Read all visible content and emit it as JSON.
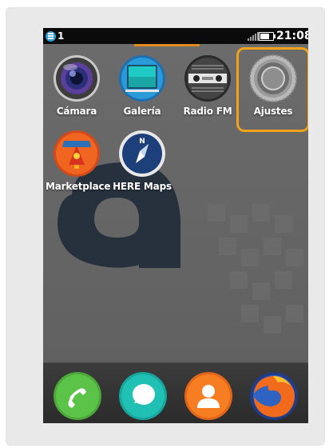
{
  "status_bar": {
    "notification_count": "1",
    "time": "21:08",
    "battery_level": 0.7
  },
  "home_apps": [
    {
      "label": "Cámara",
      "icon": "camera-icon"
    },
    {
      "label": "Galería",
      "icon": "gallery-icon"
    },
    {
      "label": "Radio FM",
      "icon": "radio-icon"
    },
    {
      "label": "Ajustes",
      "icon": "settings-gear-icon"
    },
    {
      "label": "Marketplace",
      "icon": "marketplace-icon"
    },
    {
      "label": "HERE Maps",
      "icon": "compass-icon"
    }
  ],
  "highlighted_app": "Ajustes",
  "dock_apps": [
    {
      "icon": "phone-icon"
    },
    {
      "icon": "messages-icon"
    },
    {
      "icon": "contacts-icon"
    },
    {
      "icon": "firefox-icon"
    }
  ],
  "colors": {
    "highlight": "#f0a21a",
    "page_indicator": "#e08a1c"
  }
}
